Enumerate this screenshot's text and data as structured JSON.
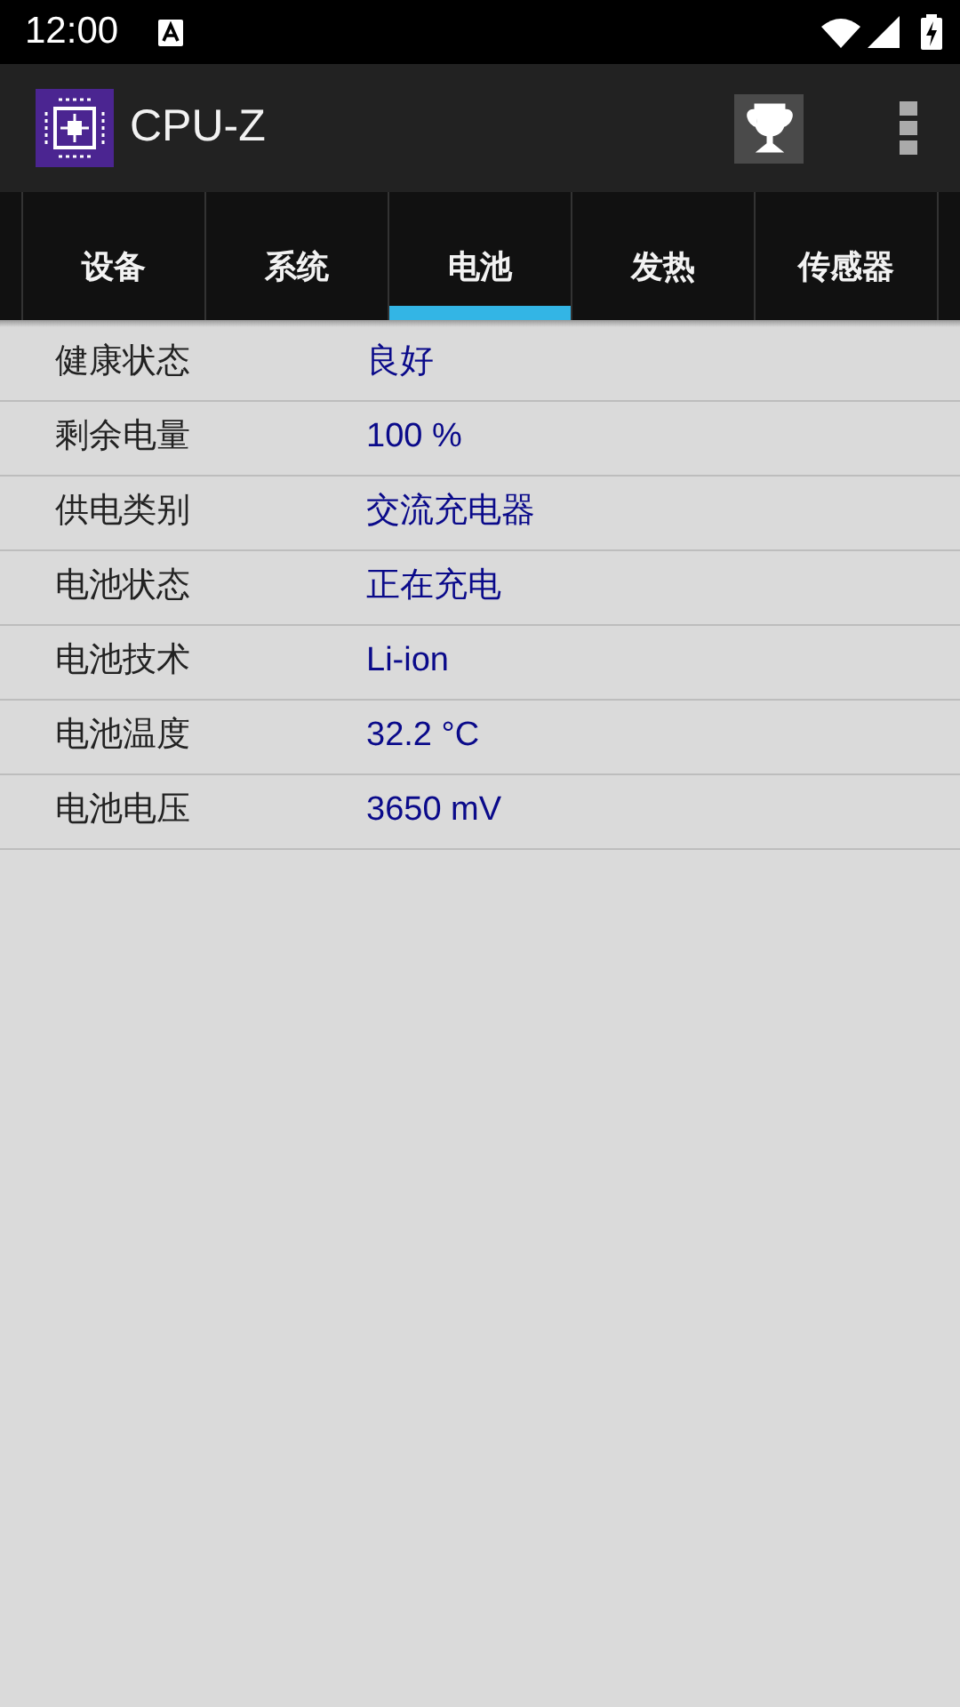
{
  "status_bar": {
    "time": "12:00"
  },
  "app_bar": {
    "title": "CPU-Z"
  },
  "tabs": [
    {
      "label": "设备",
      "selected": false
    },
    {
      "label": "系统",
      "selected": false
    },
    {
      "label": "电池",
      "selected": true
    },
    {
      "label": "发热",
      "selected": false
    },
    {
      "label": "传感器",
      "selected": false
    }
  ],
  "rows": [
    {
      "label": "健康状态",
      "value": "良好"
    },
    {
      "label": "剩余电量",
      "value": "100 %"
    },
    {
      "label": "供电类别",
      "value": "交流充电器"
    },
    {
      "label": "电池状态",
      "value": "正在充电"
    },
    {
      "label": "电池技术",
      "value": "Li-ion"
    },
    {
      "label": "电池温度",
      "value": "32.2 °C"
    },
    {
      "label": "电池电压",
      "value": "3650 mV"
    }
  ]
}
